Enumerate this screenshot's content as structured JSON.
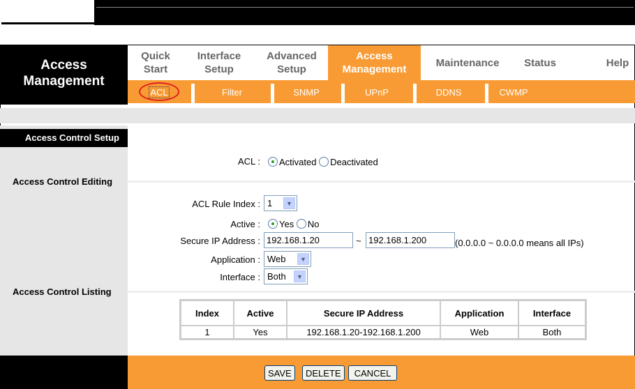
{
  "brand": {
    "line1": "Access",
    "line2": "Management"
  },
  "tabs": [
    {
      "l1": "Quick",
      "l2": "Start"
    },
    {
      "l1": "Interface",
      "l2": "Setup"
    },
    {
      "l1": "Advanced",
      "l2": "Setup"
    },
    {
      "l1": "Access",
      "l2": "Management"
    },
    {
      "l1": "Maintenance"
    },
    {
      "l1": "Status"
    },
    {
      "l1": "Help"
    }
  ],
  "subtabs": [
    "ACL",
    "Filter",
    "SNMP",
    "UPnP",
    "DDNS",
    "CWMP"
  ],
  "sidebar": {
    "setup": "Access Control Setup",
    "editing": "Access Control Editing",
    "listing": "Access Control Listing"
  },
  "form": {
    "acl_label": "ACL :",
    "activated": "Activated",
    "deactivated": "Deactivated",
    "rule_index_label": "ACL Rule Index :",
    "rule_index": "1",
    "active_label": "Active :",
    "yes": "Yes",
    "no": "No",
    "ip_label": "Secure IP Address :",
    "ip_start": "192.168.1.20",
    "tilde": "~",
    "ip_end": "192.168.1.200",
    "ip_hint": "(0.0.0.0 ~ 0.0.0.0 means all IPs)",
    "app_label": "Application :",
    "app": "Web",
    "iface_label": "Interface :",
    "iface": "Both"
  },
  "table": {
    "headers": [
      "Index",
      "Active",
      "Secure IP Address",
      "Application",
      "Interface"
    ],
    "rows": [
      [
        "1",
        "Yes",
        "192.168.1.20-192.168.1.200",
        "Web",
        "Both"
      ]
    ]
  },
  "buttons": {
    "save": "SAVE",
    "delete": "DELETE",
    "cancel": "CANCEL"
  }
}
